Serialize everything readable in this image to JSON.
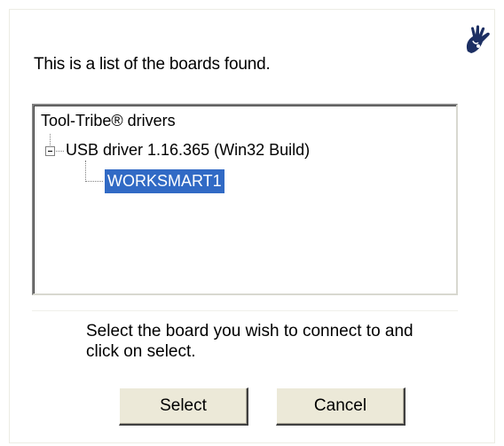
{
  "intro_text": "This is a list of the boards found.",
  "logo_icon": "hand-icon",
  "tree": {
    "root_label": "Tool-Tribe® drivers",
    "driver_label": "USB driver 1.16.365 (Win32 Build)",
    "driver_expanded": true,
    "boards": [
      {
        "label": "WORKSMART1",
        "selected": true
      }
    ]
  },
  "instruction_text": "Select the board you wish to connect to and click on select.",
  "buttons": {
    "select_label": "Select",
    "cancel_label": "Cancel"
  },
  "colors": {
    "selection": "#316ac5",
    "button_face": "#ece9d8"
  }
}
